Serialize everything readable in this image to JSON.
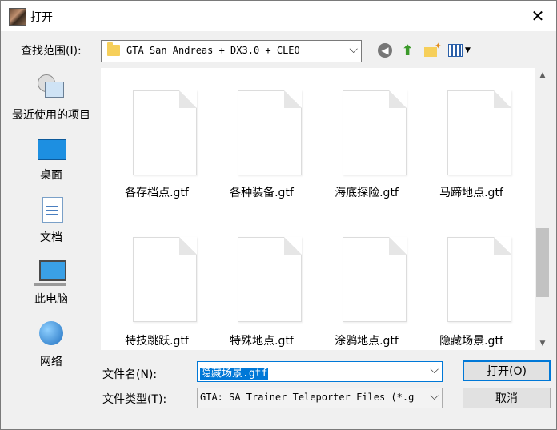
{
  "window": {
    "title": "打开",
    "close_glyph": "✕"
  },
  "lookin": {
    "label": "查找范围(I):",
    "value": "GTA San Andreas + DX3.0 + CLEO"
  },
  "toolbar": {
    "back_glyph": "◀",
    "up_glyph": "⬆"
  },
  "sidebar": {
    "items": [
      {
        "label": "最近使用的项目",
        "icon": "recent-icon"
      },
      {
        "label": "桌面",
        "icon": "desktop-icon"
      },
      {
        "label": "文档",
        "icon": "documents-icon"
      },
      {
        "label": "此电脑",
        "icon": "computer-icon"
      },
      {
        "label": "网络",
        "icon": "network-icon"
      }
    ]
  },
  "files": [
    {
      "name": "各存档点.gtf"
    },
    {
      "name": "各种装备.gtf"
    },
    {
      "name": "海底探险.gtf"
    },
    {
      "name": "马蹄地点.gtf"
    },
    {
      "name": "特技跳跃.gtf"
    },
    {
      "name": "特殊地点.gtf"
    },
    {
      "name": "涂鸦地点.gtf"
    },
    {
      "name": "隐藏场景.gtf"
    }
  ],
  "filename": {
    "label": "文件名(N):",
    "value": "隐藏场景.gtf"
  },
  "filetype": {
    "label": "文件类型(T):",
    "value": "GTA: SA Trainer Teleporter Files (*.g"
  },
  "buttons": {
    "open": "打开(O)",
    "cancel": "取消"
  },
  "colors": {
    "selection": "#0078d7",
    "folder": "#f6cf5a"
  }
}
